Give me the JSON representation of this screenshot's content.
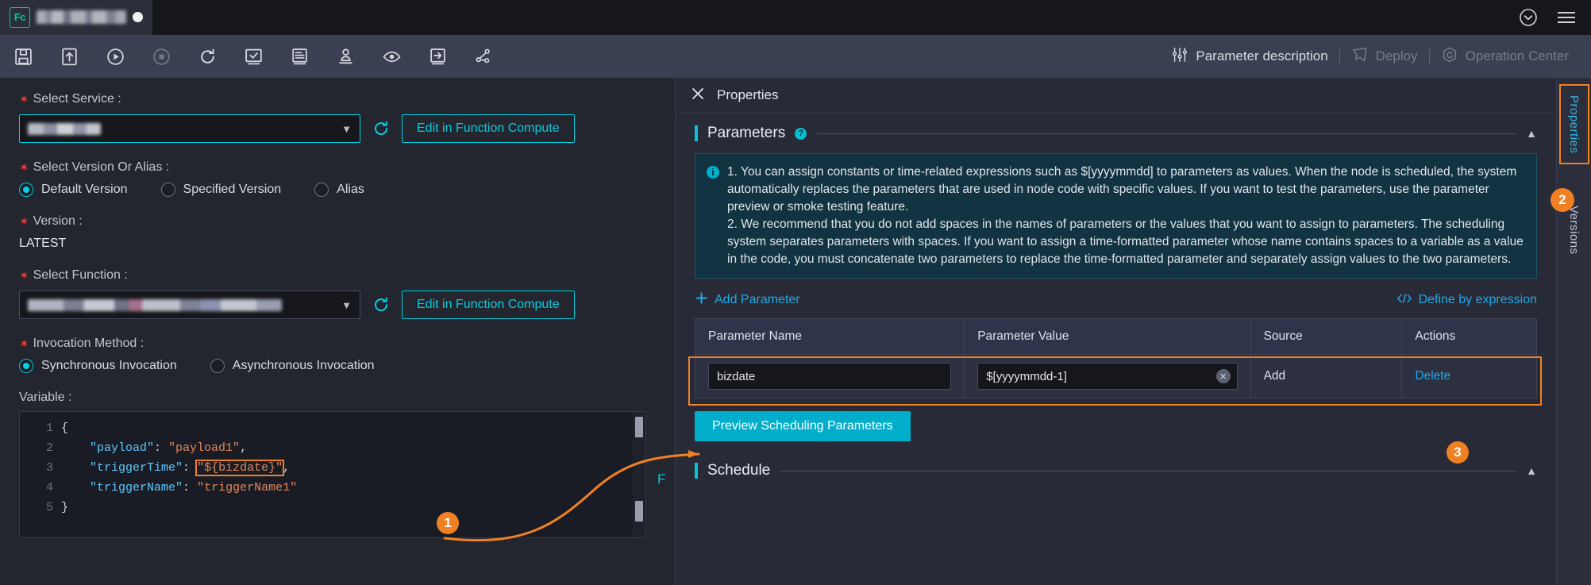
{
  "window": {
    "tab": {
      "badge": "Fc",
      "title_redacted": true,
      "modified_dot": true
    },
    "top_right_icons": [
      "collapse-circle-icon",
      "menu-icon"
    ]
  },
  "toolbar": {
    "icons": [
      {
        "name": "save-icon",
        "label": "Save",
        "disabled": false
      },
      {
        "name": "submit-icon",
        "label": "Submit",
        "disabled": false
      },
      {
        "name": "run-icon",
        "label": "Run",
        "disabled": false
      },
      {
        "name": "stop-icon",
        "label": "Stop",
        "disabled": true
      },
      {
        "name": "refresh-icon",
        "label": "Refresh",
        "disabled": false
      },
      {
        "name": "smoke-test-icon",
        "label": "Smoke Test",
        "disabled": false
      },
      {
        "name": "run-log-icon",
        "label": "Run Log",
        "disabled": false
      },
      {
        "name": "publish-icon",
        "label": "Publish",
        "disabled": false
      },
      {
        "name": "preview-icon",
        "label": "Preview",
        "disabled": false
      },
      {
        "name": "go-to-icon",
        "label": "Go To",
        "disabled": false
      },
      {
        "name": "lineage-icon",
        "label": "Lineage",
        "disabled": false
      }
    ],
    "right": {
      "parameter_description": "Parameter description",
      "parameter_description_icon": "sliders-icon",
      "deploy": "Deploy",
      "deploy_icon": "deploy-icon",
      "deploy_disabled": true,
      "operation_center": "Operation Center",
      "operation_center_icon": "operation-center-icon",
      "operation_center_disabled": true
    }
  },
  "form": {
    "select_service": {
      "label": "Select Service",
      "required": true,
      "value_redacted": true,
      "caret": "⌄"
    },
    "edit_in_fc_1": "Edit in Function Compute",
    "select_version_or_alias": {
      "label": "Select Version Or Alias",
      "required": true,
      "options": [
        "Default Version",
        "Specified Version",
        "Alias"
      ],
      "selected": "Default Version"
    },
    "version": {
      "label": "Version",
      "required": true,
      "value": "LATEST"
    },
    "select_function": {
      "label": "Select Function",
      "required": true,
      "value_redacted": true
    },
    "edit_in_fc_2": "Edit in Function Compute",
    "invocation_method": {
      "label": "Invocation Method",
      "required": true,
      "options": [
        "Synchronous Invocation",
        "Asynchronous Invocation"
      ],
      "selected": "Synchronous Invocation"
    },
    "variable": {
      "label": "Variable"
    },
    "code": {
      "lines": [
        "1",
        "2",
        "3",
        "4",
        "5"
      ],
      "text": [
        {
          "indent": 0,
          "parts": [
            {
              "t": "{",
              "c": "punc"
            }
          ]
        },
        {
          "indent": 1,
          "parts": [
            {
              "t": "\"payload\"",
              "c": "key"
            },
            {
              "t": ": ",
              "c": "punc"
            },
            {
              "t": "\"payload1\"",
              "c": "str"
            },
            {
              "t": ",",
              "c": "punc"
            }
          ]
        },
        {
          "indent": 1,
          "parts": [
            {
              "t": "\"triggerTime\"",
              "c": "key"
            },
            {
              "t": ": ",
              "c": "punc"
            },
            {
              "t": "\"${bizdate}\"",
              "c": "str",
              "highlight": true
            },
            {
              "t": ",",
              "c": "punc"
            }
          ]
        },
        {
          "indent": 1,
          "parts": [
            {
              "t": "\"triggerName\"",
              "c": "key"
            },
            {
              "t": ": ",
              "c": "punc"
            },
            {
              "t": "\"triggerName1\"",
              "c": "str"
            }
          ]
        },
        {
          "indent": 0,
          "parts": [
            {
              "t": "}",
              "c": "punc"
            }
          ]
        }
      ]
    },
    "clipped_label": "F"
  },
  "properties": {
    "close_icon": "close-icon",
    "title": "Properties",
    "parameters": {
      "title": "Parameters",
      "help_icon": "question-icon",
      "collapse_icon": "chevron-up-icon",
      "info": "1. You can assign constants or time-related expressions such as $[yyyymmdd] to parameters as values. When the node is scheduled, the system automatically replaces the parameters that are used in node code with specific values. If you want to test the parameters, use the parameter preview or smoke testing feature.\n2. We recommend that you do not add spaces in the names of parameters or the values that you want to assign to parameters. The scheduling system separates parameters with spaces. If you want to assign a time-formatted parameter whose name contains spaces to a variable as a value in the code, you must concatenate two parameters to replace the time-formatted parameter and separately assign values to the two parameters.",
      "add_parameter": "Add Parameter",
      "add_parameter_icon": "plus-icon",
      "define_by_expression": "Define by expression",
      "define_by_expression_icon": "code-brackets-icon",
      "table": {
        "headers": [
          "Parameter Name",
          "Parameter Value",
          "Source",
          "Actions"
        ],
        "rows": [
          {
            "name": "bizdate",
            "value": "$[yyyymmdd-1]",
            "value_clear_icon": "clear-icon",
            "source": "Add",
            "action": "Delete"
          }
        ]
      },
      "preview_button": "Preview Scheduling Parameters"
    },
    "schedule": {
      "title": "Schedule",
      "collapse_icon": "chevron-up-icon"
    }
  },
  "rail": {
    "tabs": [
      {
        "label": "Properties",
        "active": true,
        "highlighted": true
      },
      {
        "label": "Versions",
        "active": false,
        "highlighted": false
      }
    ]
  },
  "annotations": {
    "colors": {
      "callout": "#f08024",
      "accent": "#00d0e0",
      "link": "#1ea8e8",
      "primary": "#00aecb"
    },
    "markers": [
      {
        "number": "1",
        "target": "code-bizdate-expression"
      },
      {
        "number": "2",
        "target": "rail-tab-versions"
      },
      {
        "number": "3",
        "target": "parameter-table-row"
      }
    ]
  }
}
